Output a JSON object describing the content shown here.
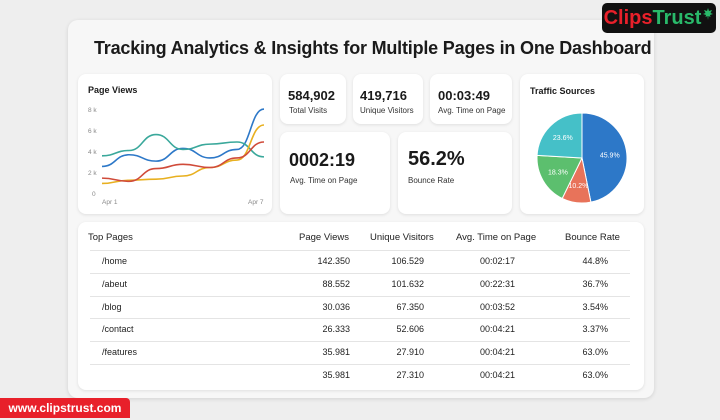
{
  "title": "Tracking Analytics & Insights for Multiple Pages in One Dashboard",
  "brand": {
    "part1": "Clips",
    "part2": "Trust",
    "icon": "maple-leaf-icon",
    "url": "www.clipstrust.com"
  },
  "page_views_chart": {
    "label": "Page Views",
    "y_ticks": [
      "8 k",
      "6 k",
      "4 k",
      "2 k",
      "0"
    ],
    "x_labels": [
      "Apr 1",
      "Apr 7"
    ]
  },
  "stats": {
    "total_visits": {
      "value": "584,902",
      "label": "Total Visits"
    },
    "unique_visitors": {
      "value": "419,716",
      "label": "Unique Visitors"
    },
    "avg_time_small": {
      "value": "00:03:49",
      "label": "Avg. Time on Page"
    },
    "avg_time_large": {
      "value": "0002:19",
      "label": "Avg. Time on Page"
    },
    "bounce_rate": {
      "value": "56.2%",
      "label": "Bounce Rate"
    }
  },
  "traffic_sources": {
    "label": "Traffic Sources",
    "slices": [
      {
        "label": "45.9%",
        "value": 45.9,
        "color": "#2d78c8"
      },
      {
        "label": "10.2%",
        "value": 10.2,
        "color": "#e8735a"
      },
      {
        "label": "18.3%",
        "value": 18.3,
        "color": "#5cbf6e"
      },
      {
        "label": "23.6%",
        "value": 23.6,
        "color": "#45c0c8"
      }
    ]
  },
  "top_pages": {
    "headers": [
      "Top Pages",
      "Page Views",
      "Unique Visitors",
      "Avg. Time on Page",
      "Bounce Rate"
    ],
    "rows": [
      [
        "/home",
        "142.350",
        "106.529",
        "00:02:17",
        "44.8%"
      ],
      [
        "/abeut",
        "88.552",
        "101.632",
        "00:22:31",
        "36.7%"
      ],
      [
        "/blog",
        "30.036",
        "67.350",
        "00:03:52",
        "3.54%"
      ],
      [
        "/contact",
        "26.333",
        "52.606",
        "00:04:21",
        "3.37%"
      ],
      [
        "/features",
        "35.981",
        "27.910",
        "00:04:21",
        "63.0%"
      ],
      [
        "",
        "35.981",
        "27.310",
        "00:04:21",
        "63.0%"
      ]
    ]
  },
  "chart_data": {
    "type": "line",
    "x": [
      1,
      2,
      3,
      4,
      5,
      6,
      7
    ],
    "x_tick_labels": [
      "Apr 1",
      "Apr 7"
    ],
    "ylim": [
      0,
      8000
    ],
    "series": [
      {
        "color": "#2d78c8",
        "values": [
          2500,
          3600,
          3000,
          4200,
          3300,
          4100,
          7900
        ]
      },
      {
        "color": "#3aa89b",
        "values": [
          3500,
          4000,
          5500,
          4100,
          4600,
          4800,
          3400
        ]
      },
      {
        "color": "#e8b020",
        "values": [
          900,
          1200,
          1300,
          1600,
          2400,
          3100,
          6400
        ]
      },
      {
        "color": "#d04b3a",
        "values": [
          1400,
          1100,
          2300,
          2700,
          2400,
          3300,
          4800
        ]
      }
    ]
  }
}
